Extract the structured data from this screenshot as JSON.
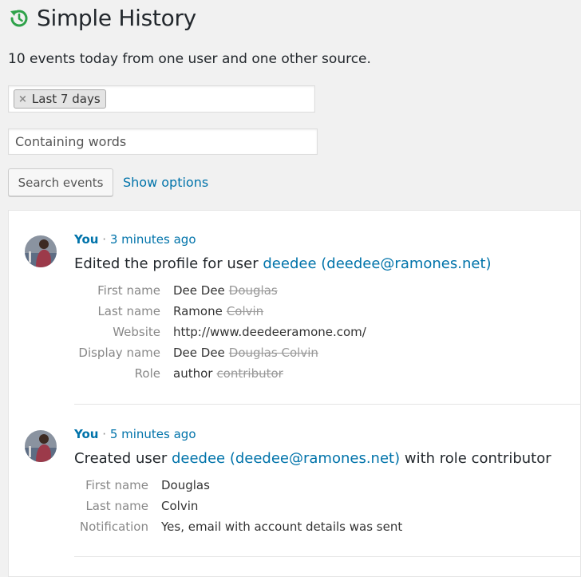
{
  "page": {
    "title": "Simple History",
    "summary": "10 events today from one user and one other source.",
    "accent_color": "#0073aa",
    "title_icon": "history-clock-icon"
  },
  "filters": {
    "date_chip_label": "Last 7 days",
    "chip_remove": "×",
    "words_placeholder": "Containing words",
    "search_button": "Search events",
    "show_options": "Show options"
  },
  "events": [
    {
      "user": "You",
      "separator": "·",
      "time": "3 minutes ago",
      "action_prefix": "Edited the profile for user ",
      "user_link": "deedee (deedee@ramones.net)",
      "action_suffix": "",
      "details": [
        {
          "label": "First name",
          "value": "Dee Dee",
          "old": "Douglas"
        },
        {
          "label": "Last name",
          "value": "Ramone",
          "old": "Colvin"
        },
        {
          "label": "Website",
          "value": "http://www.deedeeramone.com/",
          "old": ""
        },
        {
          "label": "Display name",
          "value": "Dee Dee",
          "old": "Douglas Colvin"
        },
        {
          "label": "Role",
          "value": "author",
          "old": "contributor"
        }
      ]
    },
    {
      "user": "You",
      "separator": "·",
      "time": "5 minutes ago",
      "action_prefix": "Created user ",
      "user_link": "deedee (deedee@ramones.net)",
      "action_suffix": " with role contributor",
      "details": [
        {
          "label": "First name",
          "value": "Douglas"
        },
        {
          "label": "Last name",
          "value": "Colvin"
        },
        {
          "label": "Notification",
          "value": "Yes, email with account details was sent"
        }
      ]
    }
  ]
}
